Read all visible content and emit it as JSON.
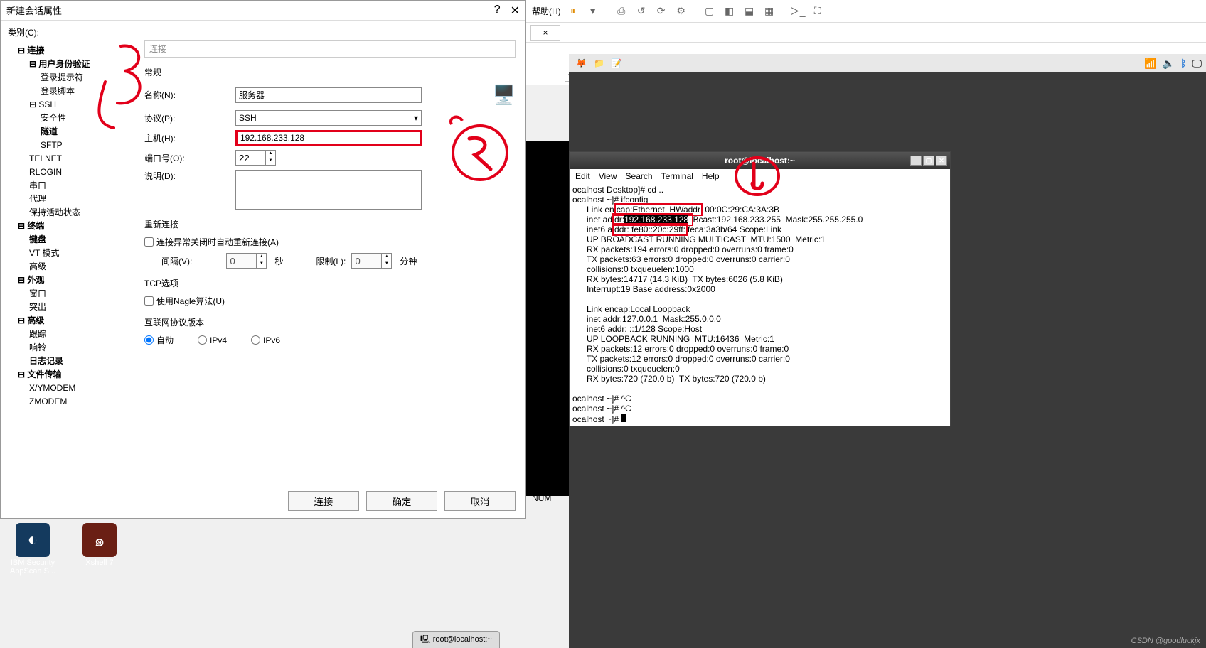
{
  "dialog": {
    "title": "新建会话属性",
    "help": "?",
    "close": "✕",
    "category_label": "类别(C):",
    "tree": {
      "connection": "连接",
      "auth": "用户身份验证",
      "login_prompt": "登录提示符",
      "login_script": "登录脚本",
      "ssh": "SSH",
      "security": "安全性",
      "tunnel": "隧道",
      "sftp": "SFTP",
      "telnet": "TELNET",
      "rlogin": "RLOGIN",
      "serial": "串口",
      "proxy": "代理",
      "keepalive": "保持活动状态",
      "terminal": "终端",
      "keyboard": "键盘",
      "vtmode": "VT 模式",
      "advanced": "高级",
      "appearance": "外观",
      "window": "窗口",
      "highlight": "突出",
      "advanced2": "高级",
      "trace": "跟踪",
      "bell": "响铃",
      "log": "日志记录",
      "ft": "文件传输",
      "xymodem": "X/YMODEM",
      "zmodem": "ZMODEM"
    },
    "crumb": "连接",
    "grp_general": "常规",
    "lbl_name": "名称(N):",
    "val_name": "服务器",
    "lbl_proto": "协议(P):",
    "val_proto": "SSH",
    "lbl_host": "主机(H):",
    "val_host": "192.168.233.128",
    "lbl_port": "端口号(O):",
    "val_port": "22",
    "lbl_desc": "说明(D):",
    "grp_reconn": "重新连接",
    "chk_reconn": "连接异常关闭时自动重新连接(A)",
    "lbl_interval": "间隔(V):",
    "val_interval": "0",
    "unit_sec": "秒",
    "lbl_limit": "限制(L):",
    "val_limit": "0",
    "unit_min": "分钟",
    "grp_tcp": "TCP选项",
    "chk_nagle": "使用Nagle算法(U)",
    "grp_ip": "互联网协议版本",
    "opt_auto": "自动",
    "opt_v4": "IPv4",
    "opt_v6": "IPv6",
    "btn_connect": "连接",
    "btn_ok": "确定",
    "btn_cancel": "取消"
  },
  "host": {
    "menu_help": "帮助(H)",
    "status_num": "NUM",
    "tab_close": "×"
  },
  "vm": {
    "tray": {
      "speaker": "🔈",
      "bt": "ᛒ",
      "screen": "🖵"
    }
  },
  "term": {
    "title": "root@localhost:~",
    "menu": {
      "edit": "Edit",
      "view": "View",
      "search": "Search",
      "terminal": "Terminal",
      "help": "Help"
    },
    "l1": "ocalhost Desktop]# cd ..",
    "l2": "ocalhost ~]# ifconfig",
    "l3a": "      Link en",
    "l3b": "cap:Ethernet  HWaddr",
    "l3c": " 00:0C:29:CA:3A:3B",
    "l4a": "      inet ad",
    "l4b": "dr:",
    "ip": "192.168.233.128",
    "l4c": "Bcast:192.168.233.255  Mask:255.255.255.0",
    "l5a": "      inet6 a",
    "l5b": "ddr: fe80::20c:29ff:",
    "l5c": "feca:3a3b/64 Scope:Link",
    "l6": "      UP BROADCAST RUNNING MULTICAST  MTU:1500  Metric:1",
    "l7": "      RX packets:194 errors:0 dropped:0 overruns:0 frame:0",
    "l8": "      TX packets:63 errors:0 dropped:0 overruns:0 carrier:0",
    "l9": "      collisions:0 txqueuelen:1000",
    "l10": "      RX bytes:14717 (14.3 KiB)  TX bytes:6026 (5.8 KiB)",
    "l11": "      Interrupt:19 Base address:0x2000",
    "l12": "",
    "l13": "      Link encap:Local Loopback",
    "l14": "      inet addr:127.0.0.1  Mask:255.0.0.0",
    "l15": "      inet6 addr: ::1/128 Scope:Host",
    "l16": "      UP LOOPBACK RUNNING  MTU:16436  Metric:1",
    "l17": "      RX packets:12 errors:0 dropped:0 overruns:0 frame:0",
    "l18": "      TX packets:12 errors:0 dropped:0 overruns:0 carrier:0",
    "l19": "      collisions:0 txqueuelen:0",
    "l20": "      RX bytes:720 (720.0 b)  TX bytes:720 (720.0 b)",
    "l21": "",
    "l22": "ocalhost ~]# ^C",
    "l23": "ocalhost ~]# ^C",
    "l24": "ocalhost ~]# "
  },
  "desk": {
    "app1_l1": "IBM Security",
    "app1_l2": "AppScan S...",
    "app2": "Xshell 7"
  },
  "task": {
    "tab": "root@localhost:~"
  },
  "watermark": "CSDN @goodluckjx"
}
